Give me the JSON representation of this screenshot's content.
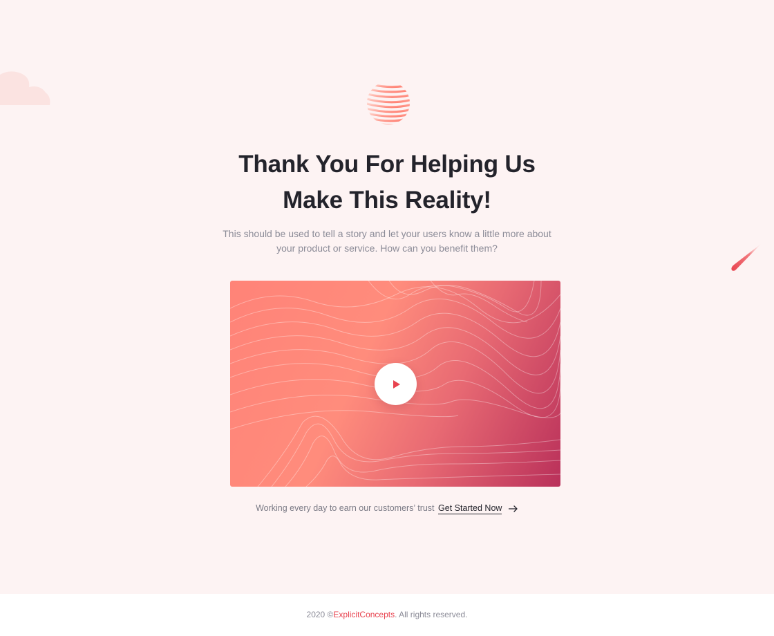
{
  "hero": {
    "headline_line1": "Thank You For Helping Us",
    "headline_line2": "Make This Reality!",
    "subtitle": "This should be used to tell a story and let your users know a little more about your product or service. How can you benefit them?",
    "logo_icon": "striped-sphere-logo-icon",
    "decorations": [
      "cloud-icon",
      "shooting-star-icon"
    ]
  },
  "video": {
    "play_icon": "play-icon"
  },
  "cta": {
    "text": "Working every day to earn our customers’ trust",
    "link_label": "Get Started Now",
    "arrow_icon": "arrow-right-icon"
  },
  "footer": {
    "prefix": "2020 ©",
    "brand": "ExplicitConcepts",
    "suffix": ". All rights reserved."
  },
  "colors": {
    "background": "#fdf3f3",
    "accent": "#e8434f",
    "heading": "#23232b",
    "muted_text": "#8b8b97",
    "video_gradient": [
      "#ff8378",
      "#ff8c7c",
      "#e86a73",
      "#b9305a"
    ]
  }
}
